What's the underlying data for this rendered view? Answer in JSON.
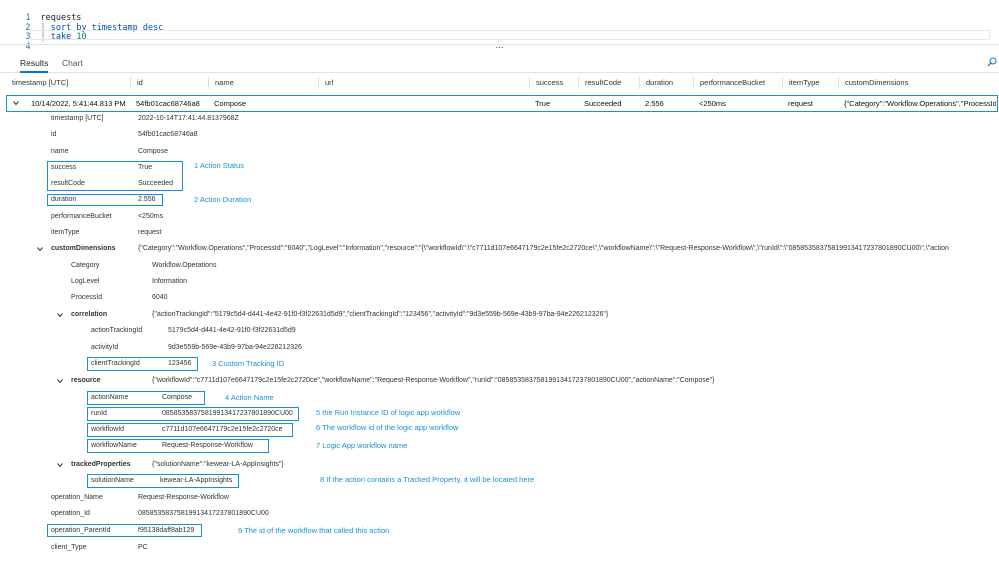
{
  "query": {
    "lines": [
      {
        "num": "1",
        "text": "requests"
      },
      {
        "num": "2",
        "pipe": "| ",
        "kw": "sort by timestamp desc"
      },
      {
        "num": "3",
        "pipe": "| ",
        "kw": "take ",
        "val": "10"
      },
      {
        "num": "4",
        "text": ""
      }
    ],
    "splitter": "..."
  },
  "tabs": [
    {
      "label": "Results",
      "active": true
    },
    {
      "label": "Chart",
      "active": false
    }
  ],
  "columns": [
    "timestamp [UTC]",
    "id",
    "name",
    "url",
    "success",
    "resultCode",
    "duration",
    "performanceBucket",
    "itemType",
    "customDimensions"
  ],
  "row": {
    "timestamp": "10/14/2022, 5:41:44.813 PM",
    "id": "54fb01cac68746a8",
    "name": "Compose",
    "url": "",
    "success": "True",
    "resultCode": "Succeeded",
    "duration": "2.556",
    "performanceBucket": "<250ms",
    "itemType": "request",
    "customDimensions": "{\"Category\":\"Workflow.Operations\",\"ProcessId\""
  },
  "details": {
    "timestamp_key": "timestamp [UTC]",
    "timestamp_val": "2022-10-14T17:41:44.8137968Z",
    "id_key": "id",
    "id_val": "54fb01cac68746a8",
    "name_key": "name",
    "name_val": "Compose",
    "success_key": "success",
    "success_val": "True",
    "resultCode_key": "resultCode",
    "resultCode_val": "Succeeded",
    "duration_key": "duration",
    "duration_val": "2.556",
    "perf_key": "performanceBucket",
    "perf_val": "<250ms",
    "itemType_key": "itemType",
    "itemType_val": "request",
    "cd_key": "customDimensions",
    "cd_val": "{\"Category\":\"Workflow.Operations\",\"ProcessId\":\"6040\",\"LogLevel\":\"Information\",\"resource\":\"{\\\"workflowId\\\":\\\"c7711d107e6647179c2e15fe2c2720ce\\\",\\\"workflowName\\\":\\\"Request-Response-Workflow\\\",\\\"runId\\\":\\\"08585358375819913417237801890CU00\\\",\\\"action",
    "category_key": "Category",
    "category_val": "Workflow.Operations",
    "loglevel_key": "LogLevel",
    "loglevel_val": "Information",
    "processid_key": "ProcessId",
    "processid_val": "6040",
    "corr_key": "correlation",
    "corr_val": "{\"actionTrackingId\":\"5179c5d4-d441-4e42-91f0-f3f22631d5d9\",\"clientTrackingId\":\"123456\",\"activityId\":\"9d3e559b-569e-43b9-97ba-94e226212326\"}",
    "atid_key": "actionTrackingId",
    "atid_val": "5179c5d4-d441-4e42-91f0-f3f22631d5d9",
    "actid_key": "activityId",
    "actid_val": "9d3e559b-569e-43b9-97ba-94e226212326",
    "ctid_key": "clientTrackingId",
    "ctid_val": "123456",
    "res_key": "resource",
    "res_val": "{\"workflowId\":\"c7711d107e6647179c2e15fe2c2720ce\",\"workflowName\":\"Request-Response-Workflow\",\"runId\":\"08585358375819913417237801890CU00\",\"actionName\":\"Compose\"}",
    "actionName_key": "actionName",
    "actionName_val": "Compose",
    "runId_key": "runId",
    "runId_val": "08585358375819913417237801890CU00",
    "workflowId_key": "workflowId",
    "workflowId_val": "c7711d107e6647179c2e15fe2c2720ce",
    "workflowName_key": "workflowName",
    "workflowName_val": "Request-Response-Workflow",
    "tp_key": "trackedProperties",
    "tp_val": "{\"solutionName\":\"kewear-LA-AppInsights\"}",
    "sol_key": "solutionName",
    "sol_val": "kewear-LA-AppInsights",
    "opname_key": "operation_Name",
    "opname_val": "Request-Response-Workflow",
    "opid_key": "operation_Id",
    "opid_val": "08585358375819913417237801890CU00",
    "oppid_key": "operation_ParentId",
    "oppid_val": "f95138daff8ab129",
    "ctype_key": "client_Type",
    "ctype_val": "PC"
  },
  "annotations": {
    "a1": "1   Action Status",
    "a2": "2   Action Duration",
    "a3": "3   Custom Tracking ID",
    "a4": "4   Action Name",
    "a5": "5   the Run Instance ID of logic app workflow",
    "a6": "6   The workflow id of the logic app workflow",
    "a7": "7   Logic App workflow name",
    "a8": "8   If the action contains a Tracked Property, it will be located here",
    "a9": "9   The id of the workflow that called this action"
  },
  "colors": {
    "accent": "#1a8fd6",
    "tab_active": "#0078d4"
  }
}
